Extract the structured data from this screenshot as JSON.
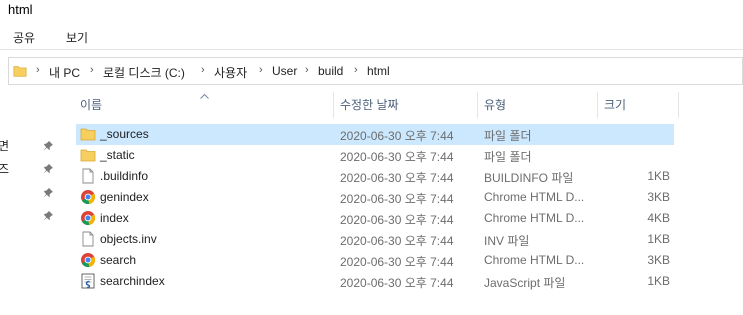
{
  "window": {
    "title": "html"
  },
  "ribbon": {
    "tabs": [
      "공유",
      "보기"
    ]
  },
  "address": {
    "crumbs": [
      "내 PC",
      "로컬 디스크 (C:)",
      "사용자",
      "User",
      "build",
      "html"
    ]
  },
  "nav_pane": {
    "cut_labels": [
      "면",
      "즈"
    ]
  },
  "columns": {
    "name": "이름",
    "date": "수정한 날짜",
    "type": "유형",
    "size": "크기"
  },
  "files": [
    {
      "name": "_sources",
      "date": "2020-06-30 오후 7:44",
      "type": "파일 폴더",
      "size": "",
      "icon": "folder-icon",
      "selected": true
    },
    {
      "name": "_static",
      "date": "2020-06-30 오후 7:44",
      "type": "파일 폴더",
      "size": "",
      "icon": "folder-icon",
      "selected": false
    },
    {
      "name": ".buildinfo",
      "date": "2020-06-30 오후 7:44",
      "type": "BUILDINFO 파일",
      "size": "1KB",
      "icon": "file-icon",
      "selected": false
    },
    {
      "name": "genindex",
      "date": "2020-06-30 오후 7:44",
      "type": "Chrome HTML D...",
      "size": "3KB",
      "icon": "chrome-icon",
      "selected": false
    },
    {
      "name": "index",
      "date": "2020-06-30 오후 7:44",
      "type": "Chrome HTML D...",
      "size": "4KB",
      "icon": "chrome-icon",
      "selected": false
    },
    {
      "name": "objects.inv",
      "date": "2020-06-30 오후 7:44",
      "type": "INV 파일",
      "size": "1KB",
      "icon": "file-icon",
      "selected": false
    },
    {
      "name": "search",
      "date": "2020-06-30 오후 7:44",
      "type": "Chrome HTML D...",
      "size": "3KB",
      "icon": "chrome-icon",
      "selected": false
    },
    {
      "name": "searchindex",
      "date": "2020-06-30 오후 7:44",
      "type": "JavaScript 파일",
      "size": "1KB",
      "icon": "script-icon",
      "selected": false
    }
  ]
}
